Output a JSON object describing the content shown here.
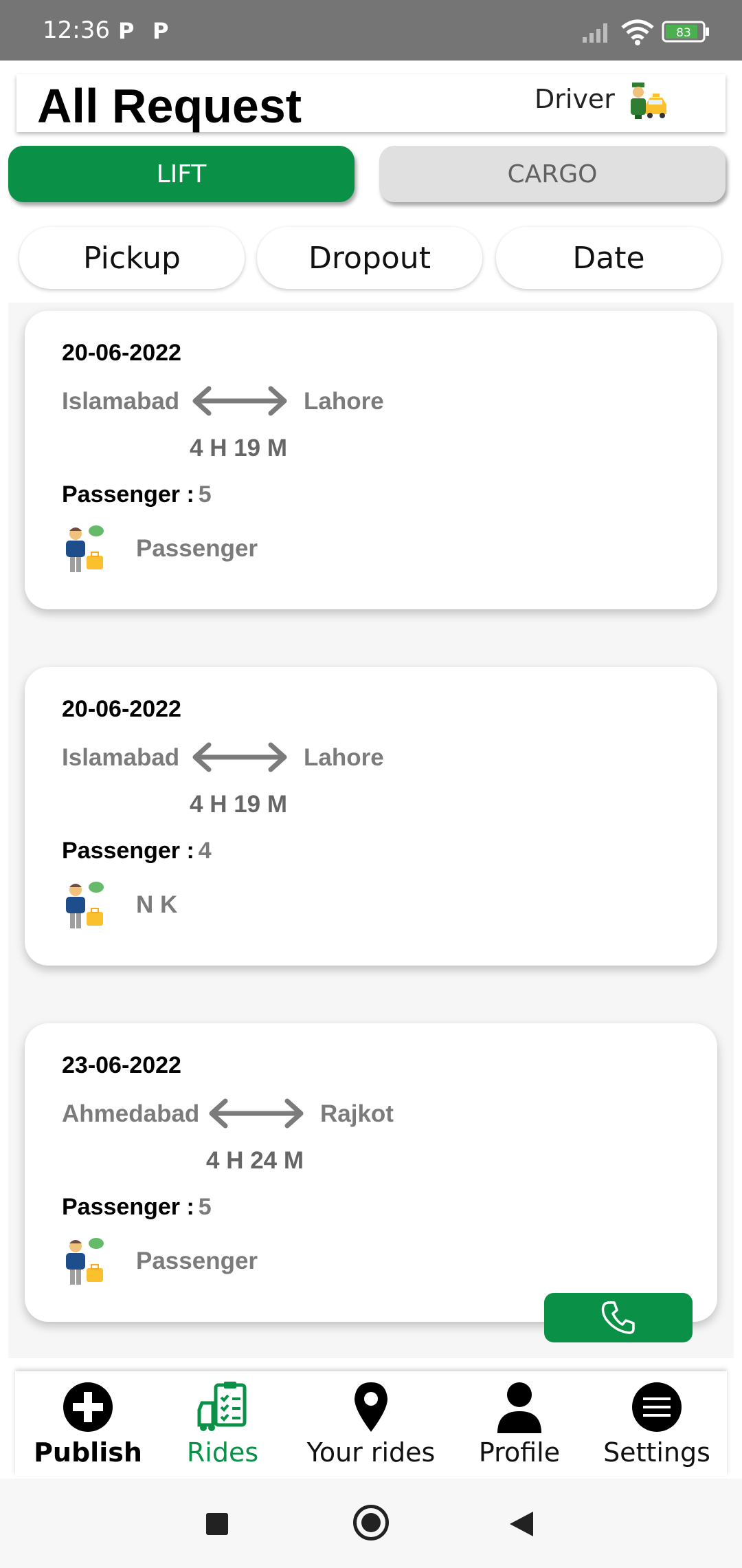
{
  "status_bar": {
    "time": "12:36",
    "notification_icons": [
      "P",
      "P"
    ],
    "battery_level": "83",
    "battery_color": "#4caf50"
  },
  "header": {
    "title": "All Request",
    "role_label": "Driver",
    "role_icon": "driver-taxi-icon"
  },
  "ride_type_tabs": {
    "lift_label": "LIFT",
    "cargo_label": "CARGO",
    "active": "LIFT",
    "active_color": "#0a9147"
  },
  "filters": [
    "Pickup",
    "Dropout",
    "Date"
  ],
  "requests": [
    {
      "date": "20-06-2022",
      "from": "Islamabad",
      "to": "Lahore",
      "duration": "4 H 19 M",
      "passenger_label": "Passenger :",
      "passenger_count": "5",
      "passenger_name": "Passenger"
    },
    {
      "date": "20-06-2022",
      "from": "Islamabad",
      "to": "Lahore",
      "duration": "4 H 19 M",
      "passenger_label": "Passenger :",
      "passenger_count": "4",
      "passenger_name": "N K"
    },
    {
      "date": "23-06-2022",
      "from": "Ahmedabad",
      "to": "Rajkot",
      "duration": "4 H 24 M",
      "passenger_label": "Passenger :",
      "passenger_count": "5",
      "passenger_name": "Passenger"
    }
  ],
  "call_button_icon": "phone-icon",
  "bottom_nav": [
    {
      "label": "Publish",
      "icon": "plus-circle-icon",
      "active": false
    },
    {
      "label": "Rides",
      "icon": "rides-list-icon",
      "active": true
    },
    {
      "label": "Your rides",
      "icon": "location-pin-icon",
      "active": false
    },
    {
      "label": "Profile",
      "icon": "person-icon",
      "active": false
    },
    {
      "label": "Settings",
      "icon": "menu-circle-icon",
      "active": false
    }
  ],
  "accent_color": "#0a9147"
}
